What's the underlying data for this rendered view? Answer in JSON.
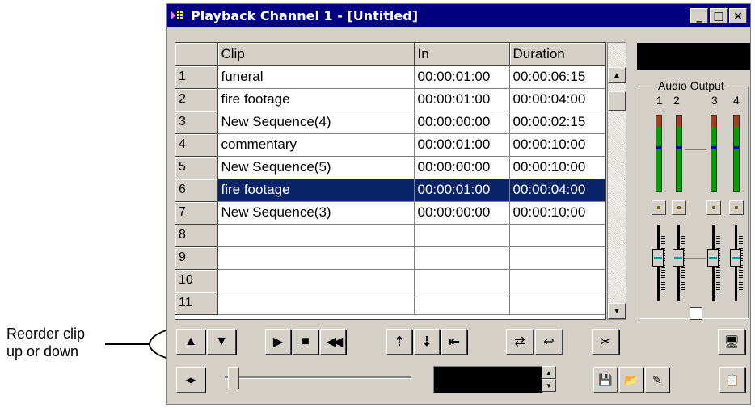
{
  "window": {
    "title": "Playback Channel 1 - [Untitled]",
    "buttons": {
      "minimize": "_",
      "maximize": "□",
      "close": "×"
    }
  },
  "grid": {
    "columns": [
      "Clip",
      "In",
      "Duration"
    ],
    "rows": [
      {
        "num": "1",
        "clip": "funeral",
        "in": "00:00:01:00",
        "duration": "00:00:06:15"
      },
      {
        "num": "2",
        "clip": "fire footage",
        "in": "00:00:01:00",
        "duration": "00:00:04:00"
      },
      {
        "num": "3",
        "clip": "New Sequence(4)",
        "in": "00:00:00:00",
        "duration": "00:00:02:15"
      },
      {
        "num": "4",
        "clip": "commentary",
        "in": "00:00:01:00",
        "duration": "00:00:10:00"
      },
      {
        "num": "5",
        "clip": "New Sequence(5)",
        "in": "00:00:00:00",
        "duration": "00:00:10:00"
      },
      {
        "num": "6",
        "clip": "fire footage",
        "in": "00:00:01:00",
        "duration": "00:00:04:00"
      },
      {
        "num": "7",
        "clip": "New Sequence(3)",
        "in": "00:00:00:00",
        "duration": "00:00:10:00"
      },
      {
        "num": "8",
        "clip": "",
        "in": "",
        "duration": ""
      },
      {
        "num": "9",
        "clip": "",
        "in": "",
        "duration": ""
      },
      {
        "num": "10",
        "clip": "",
        "in": "",
        "duration": ""
      },
      {
        "num": "11",
        "clip": "",
        "in": "",
        "duration": ""
      }
    ],
    "selected_row": "6"
  },
  "audio": {
    "label": "Audio Output",
    "channels": [
      "1",
      "2",
      "3",
      "4"
    ]
  },
  "transport": {
    "up": "▲",
    "down": "▼",
    "play": "▶",
    "stop": "■",
    "rewind": "◀◀",
    "move_top": "⇡",
    "move_bottom": "⇣",
    "go_start": "⇤",
    "loop": "⇄",
    "return": "↩",
    "cut": "✂",
    "monitor": "🖥"
  },
  "bottom_bar": {
    "expand": "◂▸",
    "save": "💾",
    "open": "📂",
    "edit": "✎",
    "clipboard": "📋"
  },
  "callout": {
    "line1": "Reorder clip",
    "line2": "up or down"
  }
}
